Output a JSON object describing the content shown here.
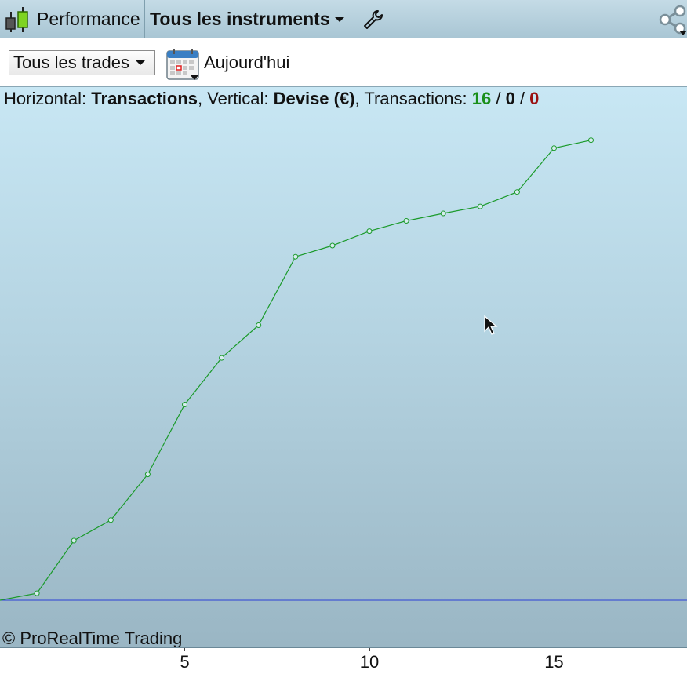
{
  "toolbar": {
    "performance_label": "Performance",
    "instruments_label": "Tous les instruments"
  },
  "filters": {
    "trades_label": "Tous les trades",
    "date_label": "Aujourd'hui"
  },
  "chart_header": {
    "horizontal_prefix": "Horizontal: ",
    "horizontal_value": "Transactions",
    "vertical_prefix": ", Vertical: ",
    "vertical_value": "Devise (€)",
    "transactions_prefix": ", Transactions: ",
    "count_total": "16",
    "sep1": " / ",
    "count_neutral": "0",
    "sep2": " / ",
    "count_losing": "0"
  },
  "copyright": "© ProRealTime Trading",
  "colors": {
    "line": "#1a9a2a",
    "zero_line": "#2a3fd6",
    "positive": "#1a8f1a",
    "negative": "#9a1111"
  },
  "chart_data": {
    "type": "line",
    "x": [
      0,
      1,
      2,
      3,
      4,
      5,
      6,
      7,
      8,
      9,
      10,
      11,
      12,
      13,
      14,
      15,
      16
    ],
    "series": [
      {
        "values": [
          0,
          0.015,
          0.128,
          0.172,
          0.27,
          0.42,
          0.52,
          0.59,
          0.737,
          0.761,
          0.792,
          0.814,
          0.83,
          0.845,
          0.876,
          0.97,
          0.987
        ]
      }
    ],
    "x_ticks": [
      "5",
      "10",
      "15"
    ],
    "x_tick_values": [
      5,
      10,
      15
    ],
    "xlim": [
      0,
      18.6
    ],
    "ylim": [
      0,
      1.0
    ],
    "y_unit": "Devise (€)",
    "grid": false,
    "legend": "none"
  }
}
